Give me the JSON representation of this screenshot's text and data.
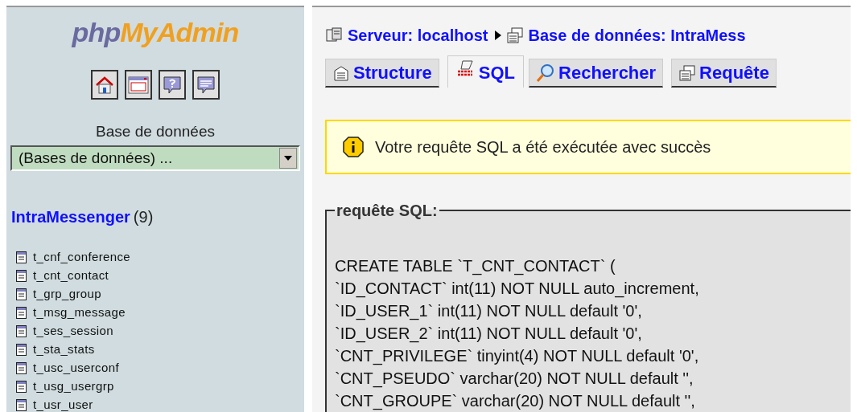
{
  "sidebar": {
    "logo": {
      "part_1": "php",
      "part_2": "MyAdmin"
    },
    "icon_buttons": [
      {
        "kind": "home"
      },
      {
        "kind": "query-window"
      },
      {
        "kind": "help"
      },
      {
        "kind": "sql-help"
      }
    ],
    "database_label": "Base de données",
    "database_select": {
      "value": "(Bases de données) ..."
    },
    "database": {
      "name": "IntraMessenger",
      "count": "(9)"
    },
    "tables": [
      "t_cnf_conference",
      "t_cnt_contact",
      "t_grp_group",
      "t_msg_message",
      "t_ses_session",
      "t_sta_stats",
      "t_usc_userconf",
      "t_usg_usergrp",
      "t_usr_user"
    ]
  },
  "breadcrumb": [
    {
      "kind": "server",
      "label": "Serveur: localhost"
    },
    {
      "kind": "database",
      "label": "Base de données: IntraMess"
    }
  ],
  "tabs": [
    {
      "kind": "structure",
      "label": "Structure",
      "selected": false
    },
    {
      "kind": "sql",
      "label": "SQL",
      "selected": true
    },
    {
      "kind": "search",
      "label": "Rechercher",
      "selected": false
    },
    {
      "kind": "query",
      "label": "Requête",
      "selected": false
    }
  ],
  "notice": "Votre requête SQL a été exécutée avec succès",
  "query": {
    "legend": "requête SQL:",
    "lines": [
      "CREATE TABLE `T_CNT_CONTACT` (",
      "`ID_CONTACT` int(11) NOT NULL auto_increment,",
      "`ID_USER_1` int(11) NOT NULL default '0',",
      "`ID_USER_2` int(11) NOT NULL default '0',",
      "`CNT_PRIVILEGE` tinyint(4) NOT NULL default '0',",
      "`CNT_PSEUDO` varchar(20) NOT NULL default '',",
      "`CNT_GROUPE` varchar(20) NOT NULL default '',"
    ]
  }
}
